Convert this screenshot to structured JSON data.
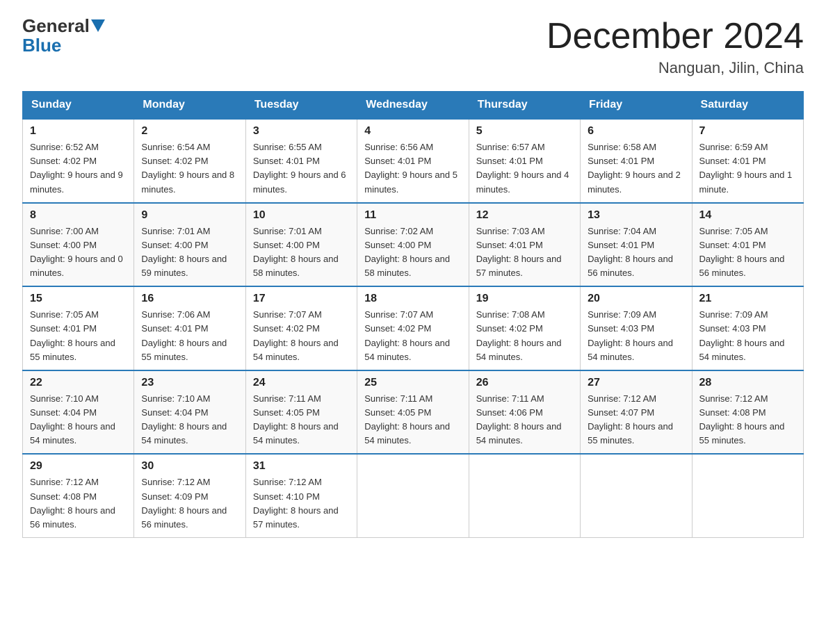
{
  "header": {
    "logo_general": "General",
    "logo_blue": "Blue",
    "month_title": "December 2024",
    "location": "Nanguan, Jilin, China"
  },
  "days_of_week": [
    "Sunday",
    "Monday",
    "Tuesday",
    "Wednesday",
    "Thursday",
    "Friday",
    "Saturday"
  ],
  "weeks": [
    [
      {
        "day": "1",
        "sunrise": "6:52 AM",
        "sunset": "4:02 PM",
        "daylight": "9 hours and 9 minutes."
      },
      {
        "day": "2",
        "sunrise": "6:54 AM",
        "sunset": "4:02 PM",
        "daylight": "9 hours and 8 minutes."
      },
      {
        "day": "3",
        "sunrise": "6:55 AM",
        "sunset": "4:01 PM",
        "daylight": "9 hours and 6 minutes."
      },
      {
        "day": "4",
        "sunrise": "6:56 AM",
        "sunset": "4:01 PM",
        "daylight": "9 hours and 5 minutes."
      },
      {
        "day": "5",
        "sunrise": "6:57 AM",
        "sunset": "4:01 PM",
        "daylight": "9 hours and 4 minutes."
      },
      {
        "day": "6",
        "sunrise": "6:58 AM",
        "sunset": "4:01 PM",
        "daylight": "9 hours and 2 minutes."
      },
      {
        "day": "7",
        "sunrise": "6:59 AM",
        "sunset": "4:01 PM",
        "daylight": "9 hours and 1 minute."
      }
    ],
    [
      {
        "day": "8",
        "sunrise": "7:00 AM",
        "sunset": "4:00 PM",
        "daylight": "9 hours and 0 minutes."
      },
      {
        "day": "9",
        "sunrise": "7:01 AM",
        "sunset": "4:00 PM",
        "daylight": "8 hours and 59 minutes."
      },
      {
        "day": "10",
        "sunrise": "7:01 AM",
        "sunset": "4:00 PM",
        "daylight": "8 hours and 58 minutes."
      },
      {
        "day": "11",
        "sunrise": "7:02 AM",
        "sunset": "4:00 PM",
        "daylight": "8 hours and 58 minutes."
      },
      {
        "day": "12",
        "sunrise": "7:03 AM",
        "sunset": "4:01 PM",
        "daylight": "8 hours and 57 minutes."
      },
      {
        "day": "13",
        "sunrise": "7:04 AM",
        "sunset": "4:01 PM",
        "daylight": "8 hours and 56 minutes."
      },
      {
        "day": "14",
        "sunrise": "7:05 AM",
        "sunset": "4:01 PM",
        "daylight": "8 hours and 56 minutes."
      }
    ],
    [
      {
        "day": "15",
        "sunrise": "7:05 AM",
        "sunset": "4:01 PM",
        "daylight": "8 hours and 55 minutes."
      },
      {
        "day": "16",
        "sunrise": "7:06 AM",
        "sunset": "4:01 PM",
        "daylight": "8 hours and 55 minutes."
      },
      {
        "day": "17",
        "sunrise": "7:07 AM",
        "sunset": "4:02 PM",
        "daylight": "8 hours and 54 minutes."
      },
      {
        "day": "18",
        "sunrise": "7:07 AM",
        "sunset": "4:02 PM",
        "daylight": "8 hours and 54 minutes."
      },
      {
        "day": "19",
        "sunrise": "7:08 AM",
        "sunset": "4:02 PM",
        "daylight": "8 hours and 54 minutes."
      },
      {
        "day": "20",
        "sunrise": "7:09 AM",
        "sunset": "4:03 PM",
        "daylight": "8 hours and 54 minutes."
      },
      {
        "day": "21",
        "sunrise": "7:09 AM",
        "sunset": "4:03 PM",
        "daylight": "8 hours and 54 minutes."
      }
    ],
    [
      {
        "day": "22",
        "sunrise": "7:10 AM",
        "sunset": "4:04 PM",
        "daylight": "8 hours and 54 minutes."
      },
      {
        "day": "23",
        "sunrise": "7:10 AM",
        "sunset": "4:04 PM",
        "daylight": "8 hours and 54 minutes."
      },
      {
        "day": "24",
        "sunrise": "7:11 AM",
        "sunset": "4:05 PM",
        "daylight": "8 hours and 54 minutes."
      },
      {
        "day": "25",
        "sunrise": "7:11 AM",
        "sunset": "4:05 PM",
        "daylight": "8 hours and 54 minutes."
      },
      {
        "day": "26",
        "sunrise": "7:11 AM",
        "sunset": "4:06 PM",
        "daylight": "8 hours and 54 minutes."
      },
      {
        "day": "27",
        "sunrise": "7:12 AM",
        "sunset": "4:07 PM",
        "daylight": "8 hours and 55 minutes."
      },
      {
        "day": "28",
        "sunrise": "7:12 AM",
        "sunset": "4:08 PM",
        "daylight": "8 hours and 55 minutes."
      }
    ],
    [
      {
        "day": "29",
        "sunrise": "7:12 AM",
        "sunset": "4:08 PM",
        "daylight": "8 hours and 56 minutes."
      },
      {
        "day": "30",
        "sunrise": "7:12 AM",
        "sunset": "4:09 PM",
        "daylight": "8 hours and 56 minutes."
      },
      {
        "day": "31",
        "sunrise": "7:12 AM",
        "sunset": "4:10 PM",
        "daylight": "8 hours and 57 minutes."
      },
      null,
      null,
      null,
      null
    ]
  ],
  "labels": {
    "sunrise": "Sunrise:",
    "sunset": "Sunset:",
    "daylight": "Daylight:"
  }
}
